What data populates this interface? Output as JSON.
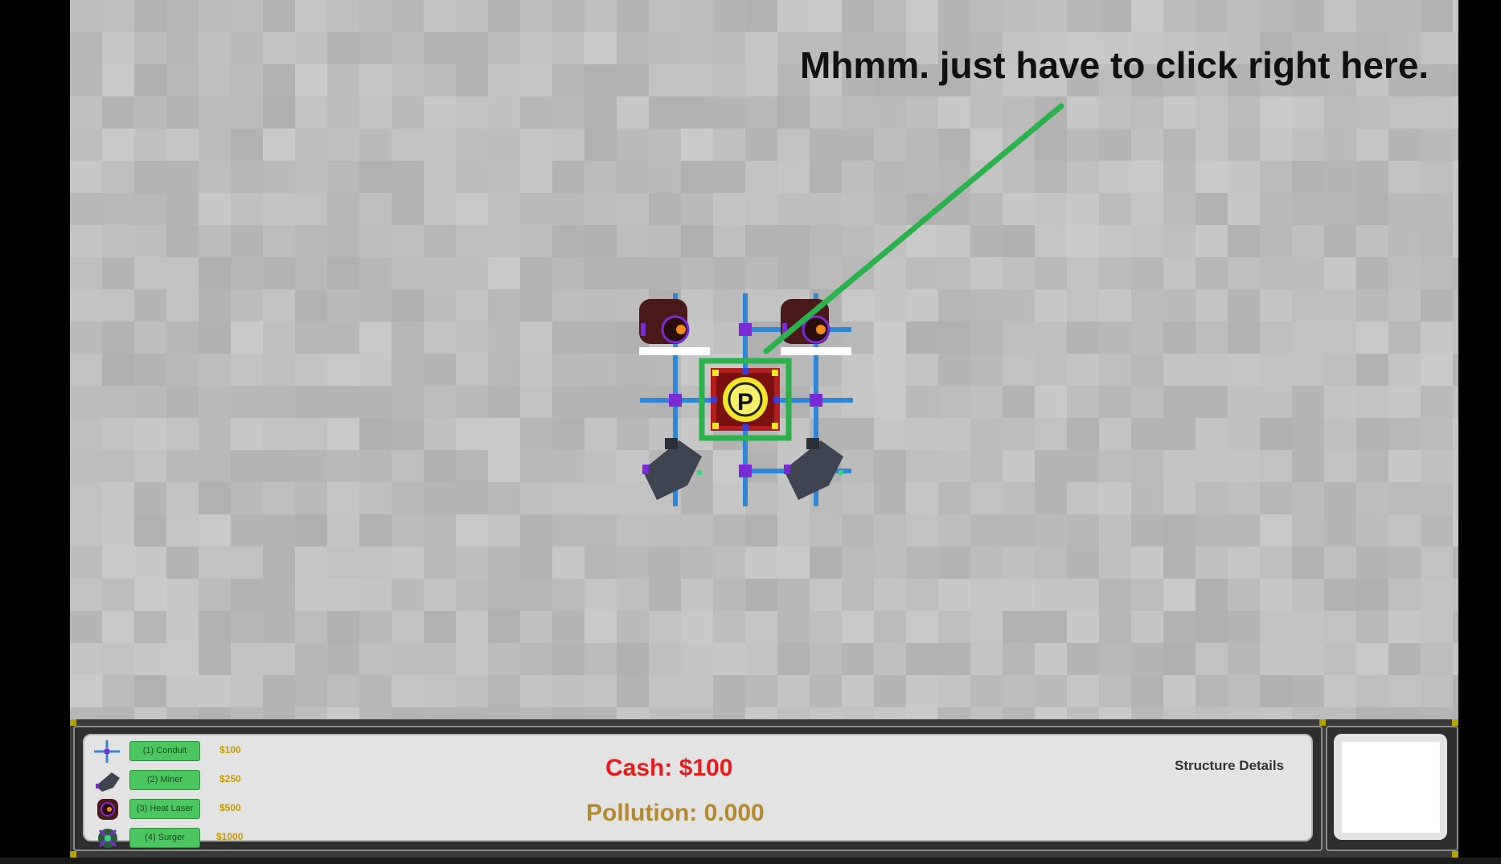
{
  "caption": "Mhmm. just have to click right here.",
  "hud": {
    "cash": "Cash: $100",
    "pollution": "Pollution: 0.000",
    "structure_details": "Structure Details",
    "shop": [
      {
        "label": "(1) Conduit",
        "price": "$100",
        "icon": "conduit-icon"
      },
      {
        "label": "(2) Miner",
        "price": "$250",
        "icon": "miner-icon"
      },
      {
        "label": "(3) Heat Laser",
        "price": "$500",
        "icon": "heat-laser-icon"
      },
      {
        "label": "(4) Surger",
        "price": "$1000",
        "icon": "surger-icon"
      }
    ]
  },
  "colors": {
    "background": "#bdbdbd",
    "pointer": "#2bb24c",
    "conduit": "#2f86d6",
    "node": "#7b2bd6",
    "button": "#4cc760",
    "cash": "#e61c1c",
    "pollution": "#b38b2e"
  },
  "structures": {
    "power_core": "P",
    "heat_lasers": 2,
    "miners": 2
  }
}
